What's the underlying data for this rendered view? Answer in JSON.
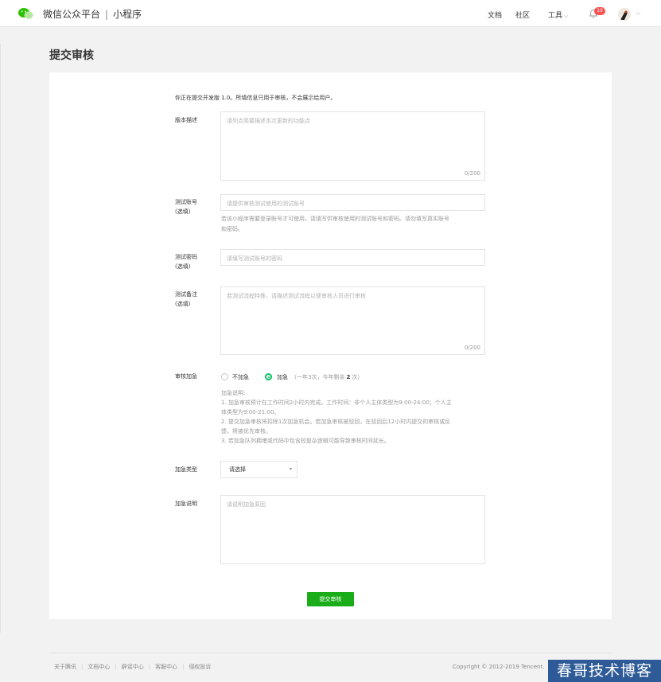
{
  "header": {
    "brand": "微信公众平台",
    "separator": "|",
    "product": "小程序",
    "nav": {
      "docs": "文档",
      "community": "社区",
      "tools": "工具"
    },
    "notification_count": "10"
  },
  "page": {
    "title": "提交审核"
  },
  "form": {
    "notice": "你正在提交开发版 1.0。所填信息只用于审核，不会展示给用户。",
    "version_desc": {
      "label": "版本描述",
      "placeholder": "请列点简要描述本次更新的功能点",
      "counter": "0/200"
    },
    "test_account": {
      "label": "测试账号",
      "optional": "(选填)",
      "placeholder": "请提供审核测试使用的测试账号",
      "tip_line1": "若该小程序需要登录账号才可使用，请填写供审核使用的测试账号和密码。请勿填写真实账号",
      "tip_line2": "和密码。"
    },
    "test_password": {
      "label": "测试密码",
      "optional": "(选填)",
      "placeholder": "请填写测试账号的密码"
    },
    "test_notes": {
      "label": "测试备注",
      "optional": "(选填)",
      "placeholder": "若测试流程特殊，请描述测试流程以便审核人员进行审核",
      "counter": "0/200"
    },
    "expedite": {
      "label": "审核加急",
      "option_no": "不加急",
      "option_yes": "加急",
      "hint_prefix": "（一年3次，今年剩余",
      "hint_count": "2",
      "hint_suffix": "次）",
      "selected": "加急",
      "note_title": "加急说明:",
      "note_1a": "1. 加急审核预计在工作时间2小时内完成。工作时间：非个人主体类型为9:00-24:00；个人主",
      "note_1b": "体类型为9:00-21:00。",
      "note_2a": "2. 提交加急审核将扣除1次加急机会。若加急审核被驳回，在驳回后12小时内提交的审核或反",
      "note_2b": "馈，将被优先审核。",
      "note_3": "3. 若加急队列拥堵或代码中包含较复杂逻辑可能导致审核时间延长。"
    },
    "expedite_type": {
      "label": "加急类型",
      "value": "请选择"
    },
    "expedite_desc": {
      "label": "加急说明",
      "placeholder": "请说明加急原因"
    },
    "submit_label": "提交审核"
  },
  "footer": {
    "links": [
      "关于腾讯",
      "文档中心",
      "辟谣中心",
      "客服中心",
      "侵权投诉"
    ],
    "copyright": "Copyright © 2012-2019 Tencent."
  },
  "watermark": "春哥技术博客",
  "icons": {
    "logo": "wechat-logo-icon",
    "bell": "bell-icon",
    "chevron": "chevron-down-icon"
  },
  "colors": {
    "primary_green": "#1aad19",
    "radio_green": "#07c160",
    "badge_red": "#fa5151",
    "watermark_blue": "#2e5b97"
  }
}
